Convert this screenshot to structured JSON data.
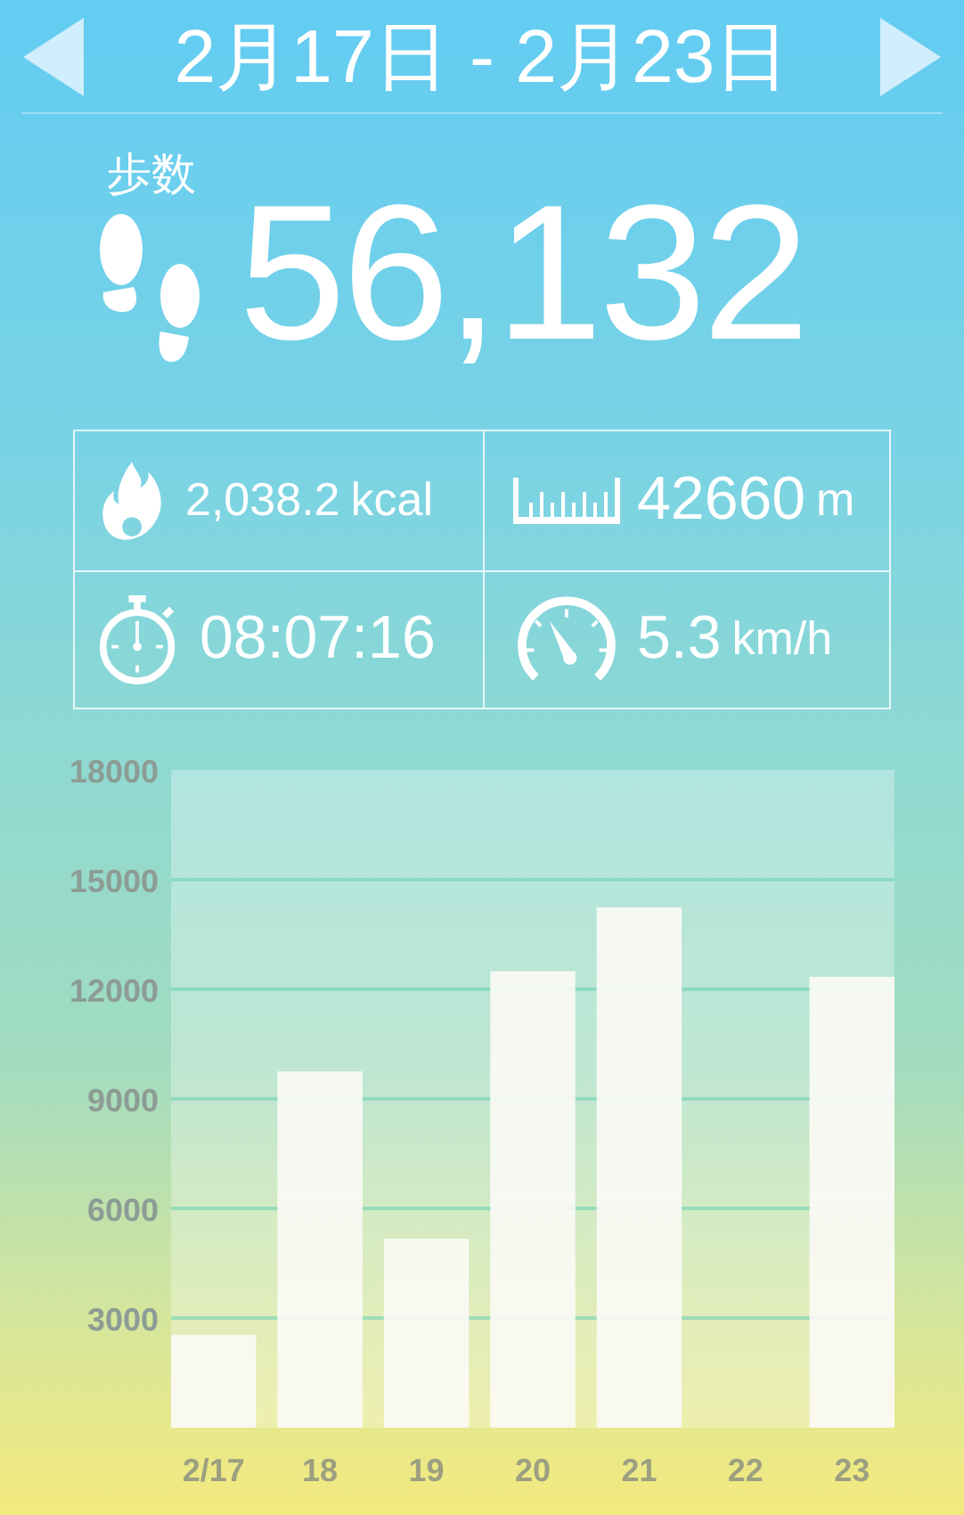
{
  "header": {
    "title": "2月17日 - 2月23日"
  },
  "steps": {
    "label": "歩数",
    "value": "56,132"
  },
  "stats": [
    {
      "kind": "calories",
      "value": "2,038.2",
      "unit": "kcal"
    },
    {
      "kind": "distance",
      "value": "42660",
      "unit": "m"
    },
    {
      "kind": "time",
      "value": "08:07:16"
    },
    {
      "kind": "speed",
      "value": "5.3",
      "unit": "km/h"
    }
  ],
  "chart": {
    "chart_data": {
      "type": "bar",
      "categories": [
        "2/17",
        "18",
        "19",
        "20",
        "21",
        "22",
        "23"
      ],
      "values": [
        2540,
        9750,
        5170,
        12490,
        14240,
        0,
        12340
      ],
      "ylim": [
        0,
        18000
      ],
      "grid": true,
      "yticks": [
        3000,
        6000,
        9000,
        12000,
        15000,
        18000
      ]
    }
  }
}
